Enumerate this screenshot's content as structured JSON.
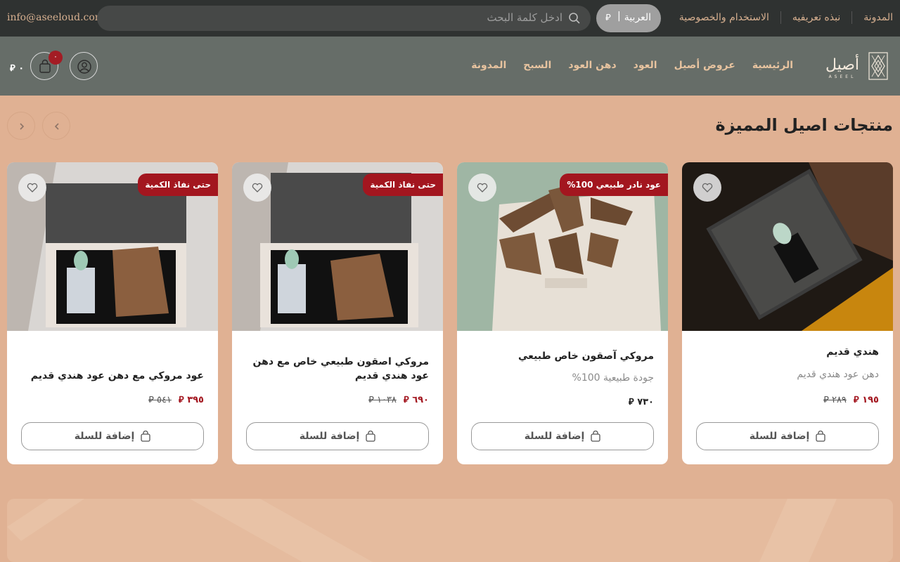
{
  "topbar": {
    "email": "info@aseeloud.com",
    "search_placeholder": "ادخل كلمة البحث",
    "lang_label": "العربية",
    "lang_sep": "|",
    "currency_symbol": "⃁",
    "links": [
      "المدونة",
      "نبذه تعريفيه",
      "الاستخدام والخصوصية"
    ]
  },
  "header": {
    "logo_text": "أصيل",
    "logo_sub": "ASEEL",
    "nav": [
      "الرئيسية",
      "عروض أصيل",
      "العود",
      "دهن العود",
      "السبح",
      "المدونة"
    ],
    "cart_count": "٠",
    "cart_total": "٠"
  },
  "section": {
    "title": "منتجات اصيل المميزة"
  },
  "products": [
    {
      "name": "هندي قديم",
      "sub": "دهن عود هندي قديم",
      "price_now": "١٩٥",
      "price_old": "٢٨٩",
      "badge": "",
      "add_label": "إضافة للسلة"
    },
    {
      "name": "مروكي آصقون خاص طبيعي",
      "sub": "جودة طبيعية 100%",
      "price_now": "٧٣٠",
      "price_old": "",
      "badge": "عود نادر طبيعي 100%",
      "add_label": "إضافة للسلة"
    },
    {
      "name": "مروكي اصقون طبيعي خاص مع دهن عود هندي قديم",
      "sub": "",
      "price_now": "٦٩٠",
      "price_old": "١٠٣٨",
      "badge": "حتى نفاذ الكمية",
      "add_label": "إضافة للسلة"
    },
    {
      "name": "عود مروكي مع دهن عود هندي قديم",
      "sub": "",
      "price_now": "٣٩٥",
      "price_old": "٥٤١",
      "badge": "حتى نفاذ الكمية",
      "add_label": "إضافة للسلة"
    }
  ],
  "colors": {
    "topbar_bg": "#2f3231",
    "header_bg": "#666d68",
    "page_bg": "#e0b193",
    "accent": "#a3161f",
    "nav_text": "#e7c39f"
  }
}
